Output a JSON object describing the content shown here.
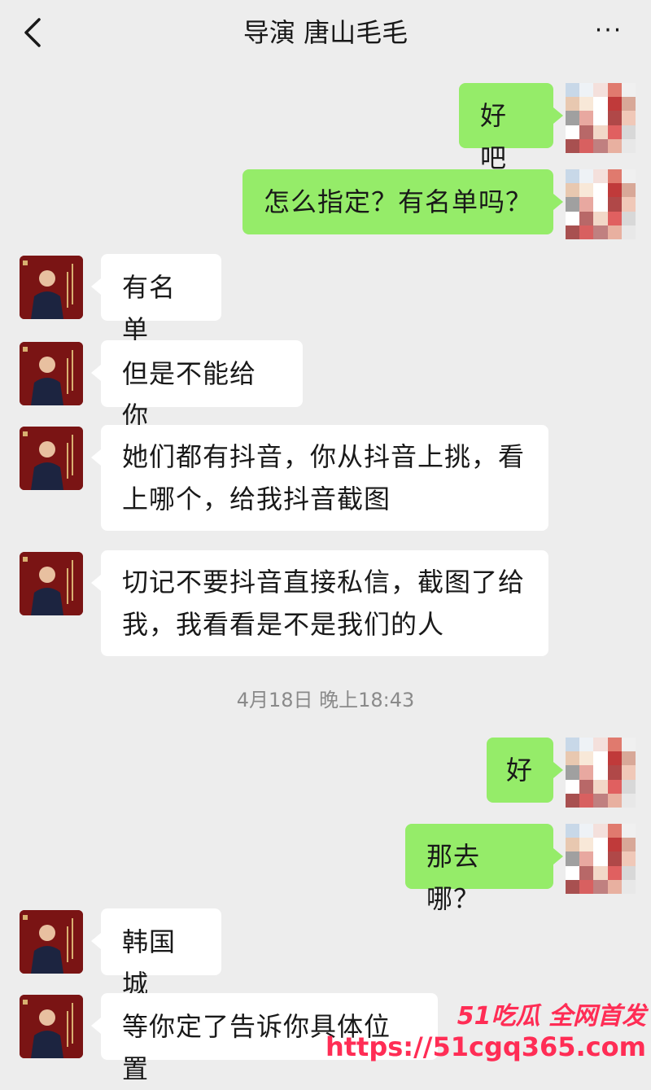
{
  "header": {
    "title": "导演 唐山毛毛",
    "back_icon": "chevron-left-icon",
    "more_label": "···"
  },
  "messages": [
    {
      "from": "me",
      "text": "好吧"
    },
    {
      "from": "me",
      "text": "怎么指定？有名单吗？"
    },
    {
      "from": "other",
      "text": "有名单"
    },
    {
      "from": "other",
      "text": "但是不能给你"
    },
    {
      "from": "other",
      "text": "她们都有抖音，你从抖音上挑，看上哪个，给我抖音截图"
    },
    {
      "from": "other",
      "text": "切记不要抖音直接私信，截图了给我，我看看是不是我们的人"
    },
    {
      "from": "me",
      "text": "好"
    },
    {
      "from": "me",
      "text": "那去哪？"
    },
    {
      "from": "other",
      "text": "韩国城"
    },
    {
      "from": "other",
      "text": "等你定了告诉你具体位置"
    }
  ],
  "timestamp": "4月18日 晚上18:43",
  "watermark": {
    "badge": "51吃瓜 全网首发",
    "url": "https://51cgq365.com"
  },
  "colors": {
    "background": "#ededed",
    "bubble_me": "#95ec69",
    "bubble_other": "#ffffff",
    "avatar_other": "#7a1414",
    "watermark": "#ff2d55"
  }
}
